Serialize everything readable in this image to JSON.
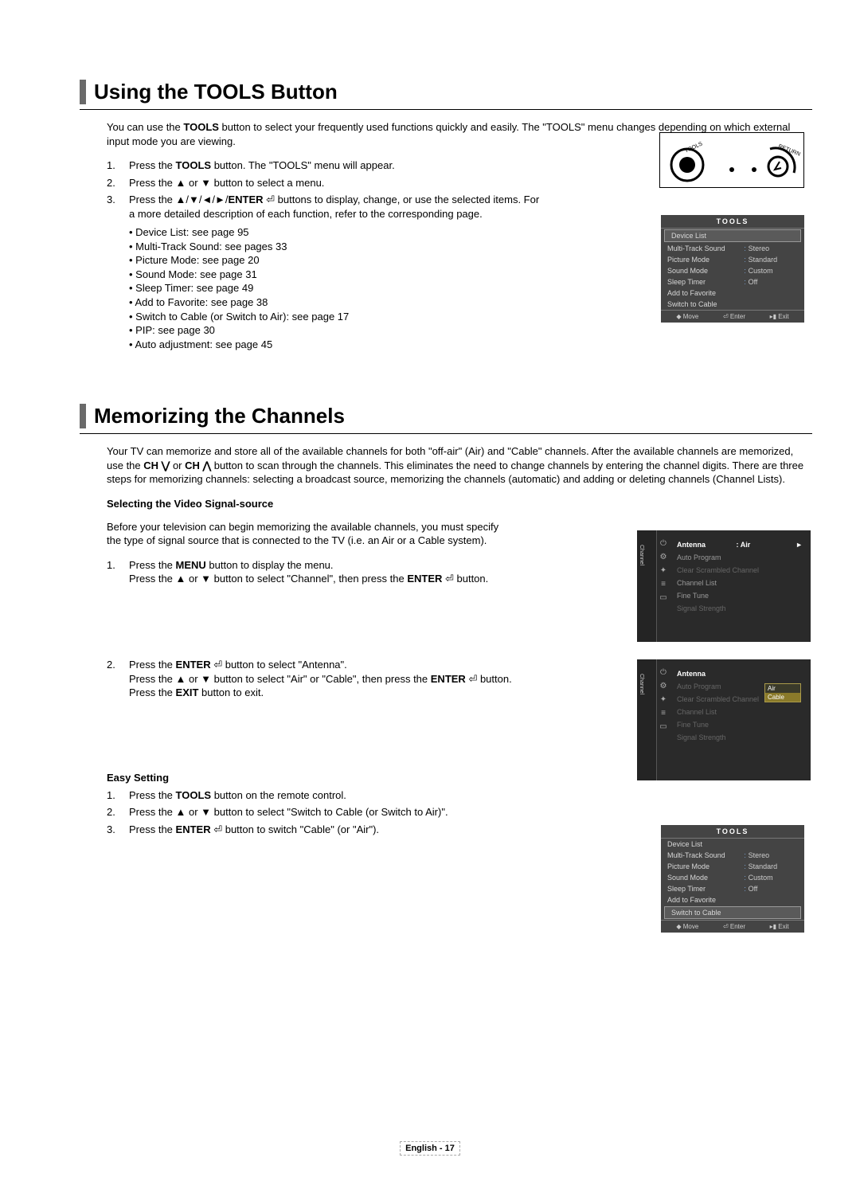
{
  "section1": {
    "title": "Using the TOOLS Button",
    "intro_before": "You can use the ",
    "intro_bold": "TOOLS",
    "intro_after": " button to select your frequently used functions quickly and easily. The \"TOOLS\" menu changes depending on which external input mode you are viewing.",
    "steps": {
      "s1a": "Press the ",
      "s1b": "TOOLS",
      "s1c": " button. The \"TOOLS\" menu will appear.",
      "s2": "Press the ▲ or ▼ button to select a menu.",
      "s3a": "Press the ▲/▼/◄/►/",
      "s3b": "ENTER",
      "s3c": " ⏎ buttons to display, change, or use the selected items. For a more detailed description of each function, refer to the corresponding page."
    },
    "bullets": [
      "Device List: see page 95",
      "Multi-Track Sound: see pages 33",
      "Picture Mode: see page 20",
      "Sound Mode: see page 31",
      "Sleep Timer: see page 49",
      "Add to Favorite: see page 38",
      "Switch to Cable (or Switch to Air): see page 17",
      "PIP: see page 30",
      "Auto adjustment: see page 45"
    ]
  },
  "tools_menu": {
    "title": "TOOLS",
    "highlighted_top": "Device List",
    "rows": [
      {
        "l": "Multi-Track Sound",
        "r": "Stereo"
      },
      {
        "l": "Picture Mode",
        "r": "Standard"
      },
      {
        "l": "Sound Mode",
        "r": "Custom"
      },
      {
        "l": "Sleep Timer",
        "r": "Off"
      },
      {
        "l": "Add to Favorite",
        "r": ""
      },
      {
        "l": "Switch to Cable",
        "r": ""
      }
    ],
    "highlighted_bottom": "Switch to Cable",
    "footer": {
      "move": "◆ Move",
      "enter": "⏎ Enter",
      "exit": "▸▮ Exit"
    }
  },
  "section2": {
    "title": "Memorizing the Channels",
    "intro_a": "Your TV can memorize and store all of the available channels for both \"off-air\" (Air) and \"Cable\" channels. After the available channels are memorized, use the ",
    "intro_b": "CH ⋁",
    "intro_c": " or ",
    "intro_d": "CH ⋀",
    "intro_e": " button to scan through the channels. This eliminates the need to change channels by entering the channel digits. There are three steps for memorizing channels: selecting a broadcast source, memorizing the channels (automatic) and adding or deleting channels (Channel Lists).",
    "sub1_head": "Selecting the Video Signal-source",
    "sub1_para": "Before your television can begin memorizing the available channels, you must specify the type of signal source that is connected to the TV (i.e. an Air or a Cable system).",
    "sub1_steps": {
      "s1a": "Press the ",
      "s1b": "MENU",
      "s1c": " button to display the menu.",
      "s1d": "Press the ▲ or ▼ button to select \"Channel\", then press the ",
      "s1e": "ENTER",
      "s1f": " ⏎ button.",
      "s2a": "Press the ",
      "s2b": "ENTER",
      "s2c": " ⏎ button to select \"Antenna\".",
      "s2d": "Press the ▲ or ▼ button to select \"Air\" or \"Cable\", then press the ",
      "s2e": "ENTER",
      "s2f": " ⏎ button.",
      "s2g": "Press the ",
      "s2h": "EXIT",
      "s2i": " button to exit."
    },
    "easy_head": "Easy Setting",
    "easy_steps": {
      "e1a": "Press the ",
      "e1b": "TOOLS",
      "e1c": " button on the remote control.",
      "e2": "Press the ▲ or ▼ button to select \"Switch to Cable (or Switch to Air)\".",
      "e3a": "Press the ",
      "e3b": "ENTER",
      "e3c": " ⏎ button to switch \"Cable\" (or \"Air\")."
    }
  },
  "osd": {
    "vlabel": "Channel",
    "antenna": "Antenna",
    "air": ": Air",
    "items": [
      "Auto Program",
      "Clear Scrambled Channel",
      "Channel List",
      "Fine Tune",
      "Signal Strength"
    ],
    "dd_air": "Air",
    "dd_cable": "Cable"
  },
  "footer": "English - 17",
  "icons": {
    "power": "⏻",
    "gear": "⚙",
    "gear2": "✦",
    "net": "≡",
    "cast": "▭"
  }
}
